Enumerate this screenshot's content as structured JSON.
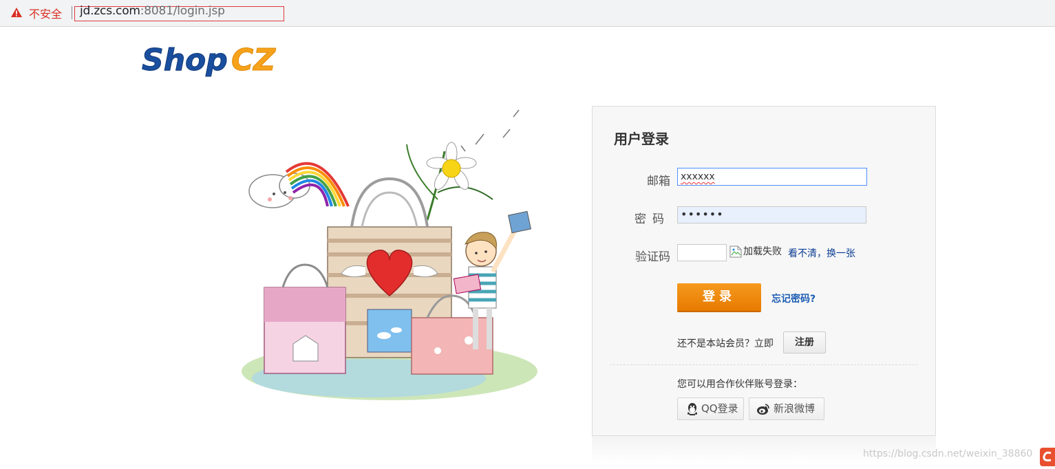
{
  "browser": {
    "security_label": "不安全",
    "url_host": "jd.zcs.com",
    "url_rest": ":8081/login.jsp"
  },
  "logo": {
    "shop": "Shop",
    "cz": "CZ"
  },
  "login": {
    "title": "用户登录",
    "email_label": "邮箱",
    "email_value": "xxxxxx",
    "password_label": "密码",
    "password_value": "••••••",
    "captcha_label": "验证码",
    "captcha_img_alt": "加载失败",
    "refresh_link": "看不清，换一张",
    "login_button": "登录",
    "forgot_link": "忘记密码?",
    "not_member": "还不是本站会员？立即",
    "register_button": "注册",
    "partner_text": "您可以用合作伙伴账号登录：",
    "qq_button": "QQ登录",
    "weibo_button": "新浪微博"
  },
  "footer": {
    "watermark": "https://blog.csdn.net/weixin_38860"
  },
  "colors": {
    "login_orange": "#f08a00",
    "link_blue": "#1a5cb3",
    "insecure_red": "#d93025"
  },
  "icons": [
    "warning-icon",
    "broken-image-icon",
    "qq-icon",
    "weibo-icon",
    "csdn-icon"
  ]
}
